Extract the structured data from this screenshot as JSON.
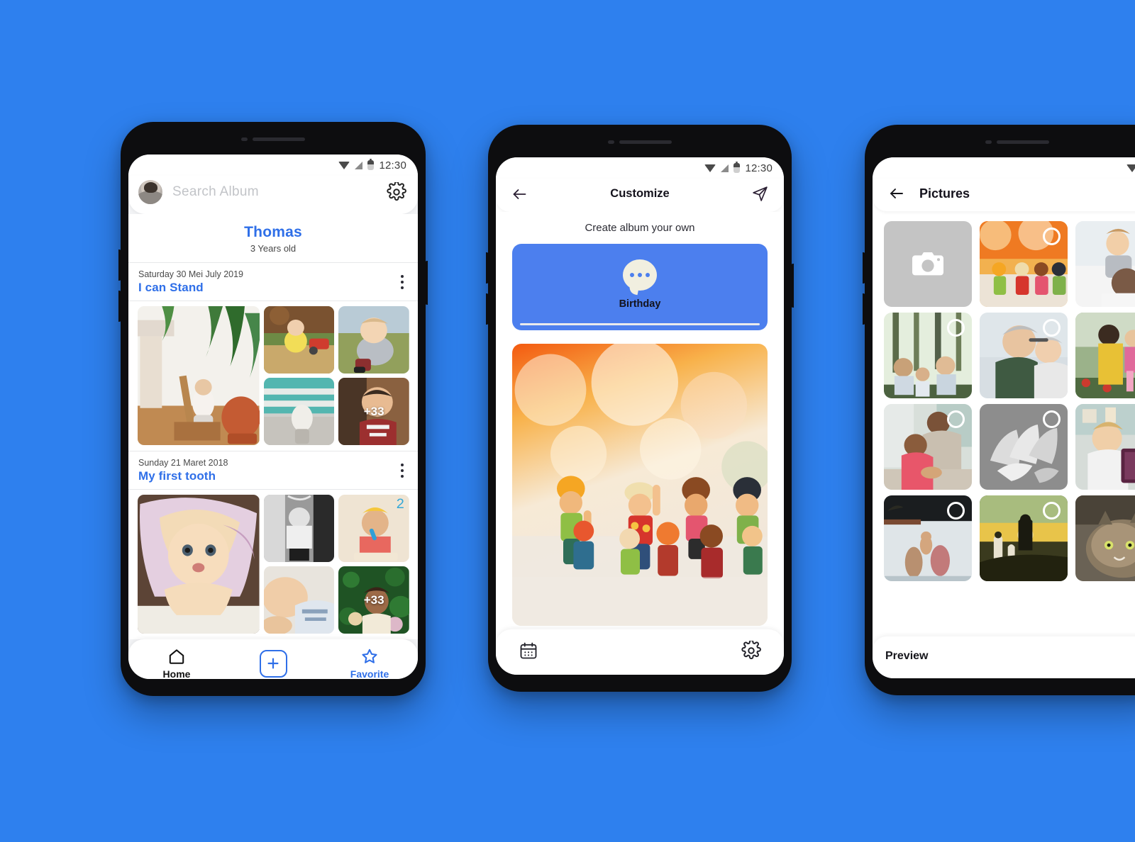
{
  "background_color": "#2e80ee",
  "accent_color": "#2f6fe8",
  "phone1": {
    "status": {
      "time": "12:30",
      "icons": [
        "wifi-icon",
        "signal-icon",
        "battery-icon"
      ]
    },
    "search": {
      "placeholder": "Search Album",
      "avatar": "user-avatar",
      "settings_icon": "gear-icon"
    },
    "profile": {
      "name": "Thomas",
      "age": "3 Years old"
    },
    "albums": [
      {
        "date": "Saturday 30 Mei July 2019",
        "title": "I can Stand",
        "menu_icon": "kebab-menu-icon",
        "overflow_badge": "+33"
      },
      {
        "date": "Sunday 21 Maret 2018",
        "title": "My first tooth",
        "menu_icon": "kebab-menu-icon",
        "overflow_badge": "+33"
      }
    ],
    "bottom_nav": [
      {
        "label": "Home",
        "icon": "home-icon",
        "active": false
      },
      {
        "label": "",
        "icon": "plus-icon",
        "active": true
      },
      {
        "label": "Favorite",
        "icon": "star-icon",
        "active": true
      }
    ]
  },
  "phone2": {
    "status": {
      "time": "12:30",
      "icons": [
        "wifi-icon",
        "signal-icon",
        "battery-icon"
      ]
    },
    "appbar": {
      "back_icon": "back-arrow-icon",
      "title": "Customize",
      "send_icon": "send-icon"
    },
    "subtitle": "Create album your own",
    "card": {
      "label": "Birthday",
      "icon": "chat-bubble-icon",
      "color": "#4c7fee"
    },
    "preview_image": "toy-figurines-photo",
    "bottom_bar": [
      {
        "icon": "calendar-icon"
      },
      {
        "icon": "gear-icon"
      }
    ]
  },
  "phone3": {
    "status": {
      "icons": [
        "wifi-icon",
        "signal-icon"
      ]
    },
    "appbar": {
      "back_icon": "back-arrow-icon",
      "title": "Pictures"
    },
    "grid": [
      {
        "type": "camera",
        "icon": "camera-icon",
        "selected": false
      },
      {
        "type": "photo",
        "name": "toy-figurines",
        "selected": true
      },
      {
        "type": "photo",
        "name": "baby-on-shoulders",
        "selected": false
      },
      {
        "type": "photo",
        "name": "family-in-forest",
        "selected": true
      },
      {
        "type": "photo",
        "name": "elderly-couple",
        "selected": true
      },
      {
        "type": "photo",
        "name": "father-lifting-child",
        "selected": false
      },
      {
        "type": "photo",
        "name": "kitchen-handwash",
        "selected": true
      },
      {
        "type": "photo",
        "name": "stacked-hands",
        "selected": true
      },
      {
        "type": "photo",
        "name": "toddler-with-tablet",
        "selected": false
      },
      {
        "type": "photo",
        "name": "family-silhouette-pool",
        "selected": true
      },
      {
        "type": "photo",
        "name": "sunset-family",
        "selected": true
      },
      {
        "type": "photo",
        "name": "cat-portrait",
        "selected": false
      }
    ],
    "bottom_bar": {
      "label": "Preview"
    }
  }
}
